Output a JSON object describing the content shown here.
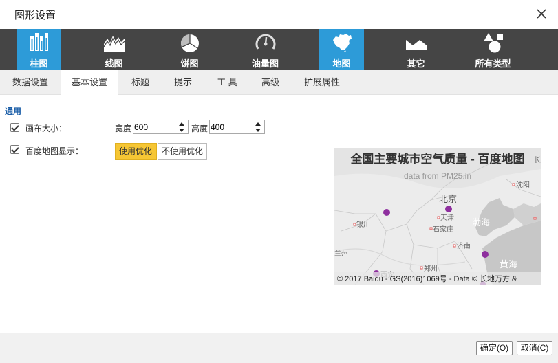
{
  "window": {
    "title": "图形设置"
  },
  "chart_types": [
    {
      "label": "柱图",
      "icon": "bar-chart-icon",
      "active": true
    },
    {
      "label": "线图",
      "icon": "line-chart-icon",
      "active": false
    },
    {
      "label": "饼图",
      "icon": "pie-chart-icon",
      "active": false
    },
    {
      "label": "油量图",
      "icon": "gauge-chart-icon",
      "active": false
    },
    {
      "label": "地图",
      "icon": "map-chart-icon",
      "active": true
    },
    {
      "label": "其它",
      "icon": "other-chart-icon",
      "active": false
    },
    {
      "label": "所有类型",
      "icon": "all-types-icon",
      "active": false
    }
  ],
  "tabs": [
    {
      "label": "数据设置",
      "active": false
    },
    {
      "label": "基本设置",
      "active": true
    },
    {
      "label": "标题",
      "active": false
    },
    {
      "label": "提示",
      "active": false
    },
    {
      "label": "工 具",
      "active": false
    },
    {
      "label": "高级",
      "active": false
    },
    {
      "label": "扩展属性",
      "active": false
    }
  ],
  "general": {
    "section_title": "通用",
    "canvas_size": {
      "label": "画布大小：",
      "checked": true,
      "width_label": "宽度",
      "width_value": "600",
      "height_label": "高度",
      "height_value": "400"
    },
    "baidu_map": {
      "label": "百度地图显示：",
      "checked": true,
      "options": [
        {
          "label": "使用优化",
          "selected": true
        },
        {
          "label": "不使用优化",
          "selected": false
        }
      ]
    }
  },
  "preview": {
    "title": "全国主要城市空气质量 - 百度地图",
    "subtitle": "data from PM25.in",
    "places": [
      {
        "name": "北京",
        "kind": "capital"
      },
      {
        "name": "天津",
        "kind": "city"
      },
      {
        "name": "石家庄",
        "kind": "city"
      },
      {
        "name": "济南",
        "kind": "city"
      },
      {
        "name": "郑州",
        "kind": "city"
      },
      {
        "name": "沈阳",
        "kind": "city"
      },
      {
        "name": "银川",
        "kind": "city"
      },
      {
        "name": "兰州",
        "kind": "city"
      },
      {
        "name": "西安",
        "kind": "city"
      },
      {
        "name": "长",
        "kind": "city"
      },
      {
        "name": "渤海",
        "kind": "sea"
      },
      {
        "name": "黄海",
        "kind": "sea"
      }
    ],
    "copyright": "© 2017 Baidu - GS(2016)1069号 - Data © 长地万方 & "
  },
  "footer": {
    "ok_label": "确定(O)",
    "cancel_label": "取消(C)"
  },
  "colors": {
    "accent": "#2d9bd8",
    "toolbar": "#454545",
    "selected_option": "#f6c634",
    "section_title": "#1c5fa8",
    "marker": "#8e2f9e"
  }
}
